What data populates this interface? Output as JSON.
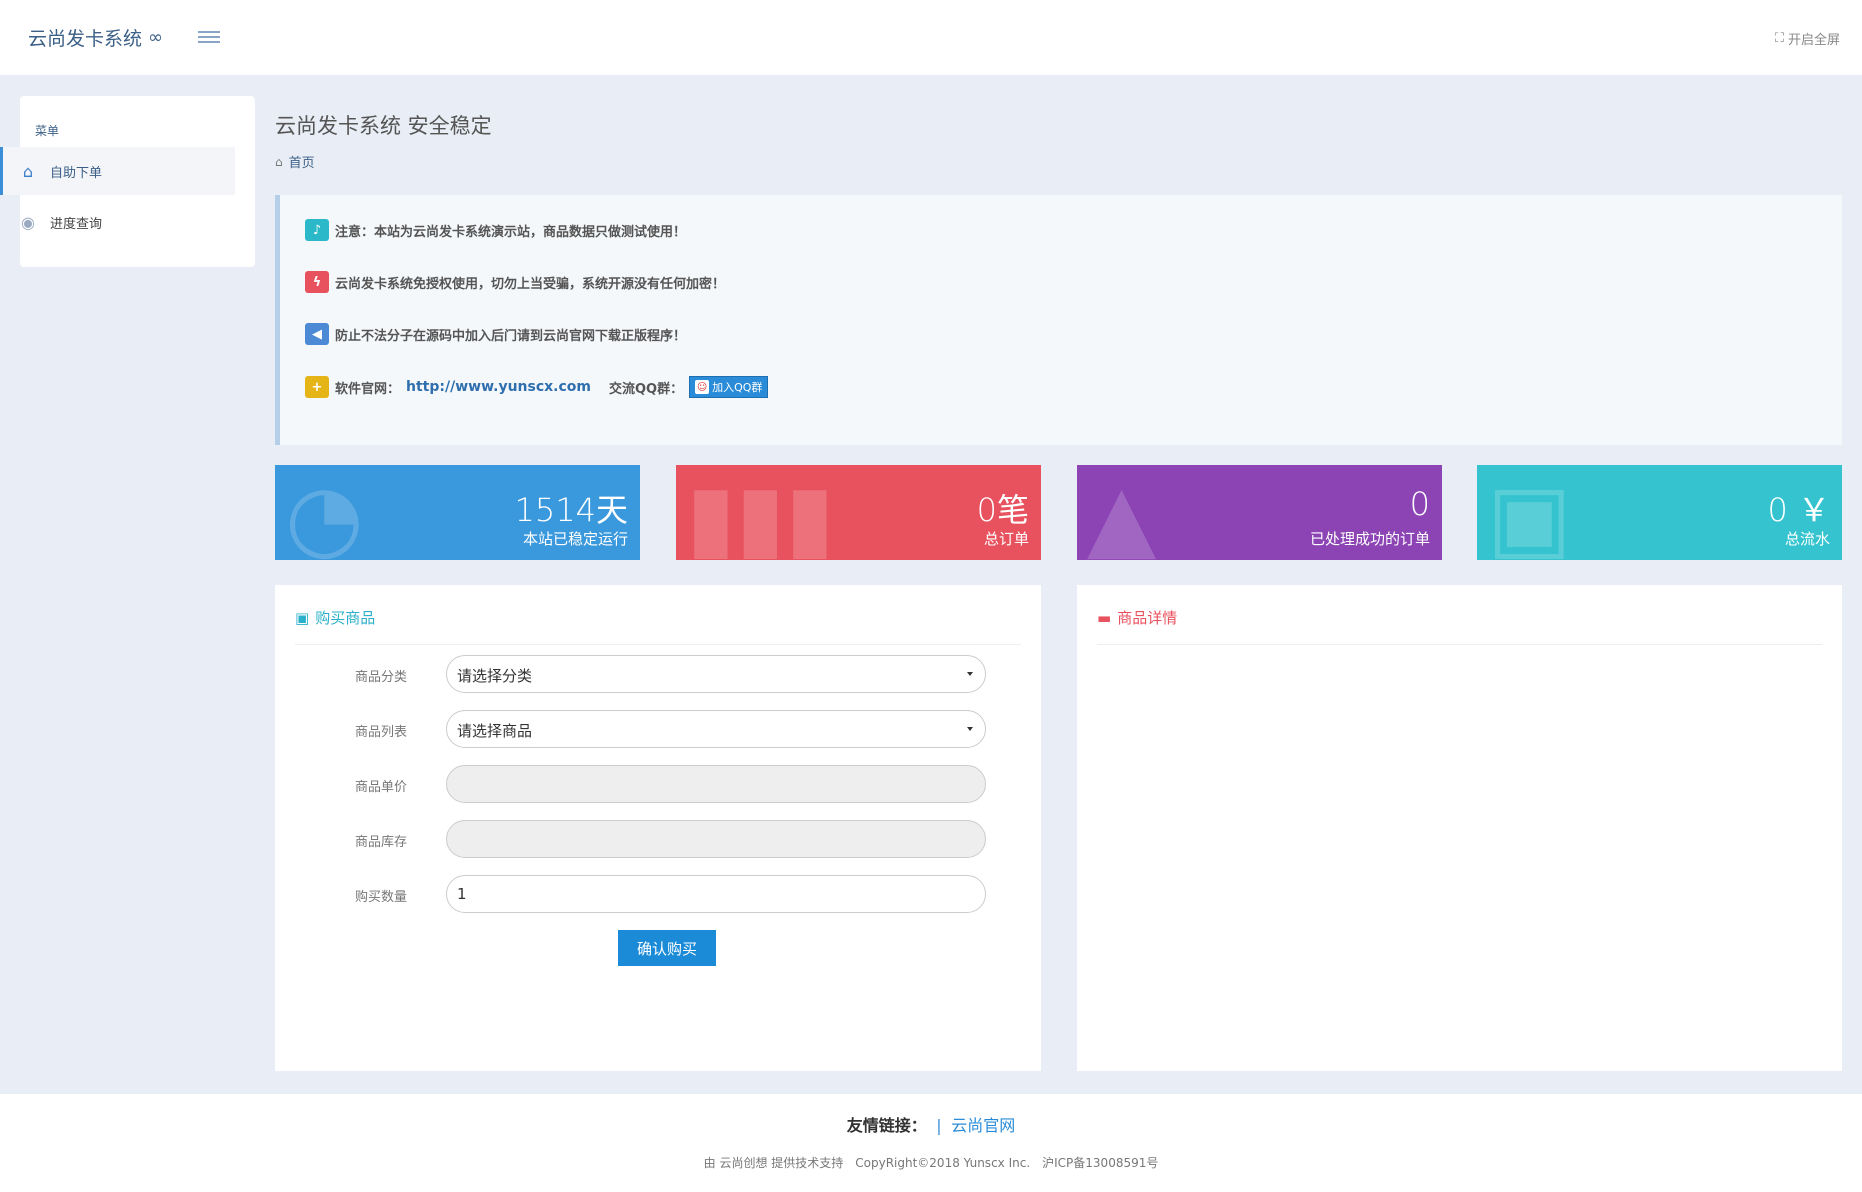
{
  "header": {
    "brand": "云尚发卡系统",
    "fullscreen": "开启全屏"
  },
  "sidebar": {
    "heading": "菜单",
    "items": [
      {
        "label": "自助下单"
      },
      {
        "label": "进度查询"
      }
    ]
  },
  "page": {
    "title": "云尚发卡系统 安全稳定",
    "breadcrumb": "首页"
  },
  "notice": {
    "line1": "注意：本站为云尚发卡系统演示站，商品数据只做测试使用！",
    "line2": "云尚发卡系统免授权使用，切勿上当受骗，系统开源没有任何加密！",
    "line3": "防止不法分子在源码中加入后门请到云尚官网下载正版程序！",
    "site_label": "软件官网：",
    "site_url": "http://www.yunscx.com",
    "qq_label": "交流QQ群：",
    "qq_button": "加入QQ群"
  },
  "stats": [
    {
      "value": "1514天",
      "label": "本站已稳定运行",
      "color": "#3a98dc"
    },
    {
      "value": "0笔",
      "label": "总订单",
      "color": "#e8525e"
    },
    {
      "value": "0",
      "label": "已处理成功的订单",
      "color": "#8c44b5"
    },
    {
      "value": "0 ￥",
      "label": "总流水",
      "color": "#35c4cf"
    }
  ],
  "buy_panel": {
    "title": "购买商品",
    "category_label": "商品分类",
    "category_value": "请选择分类",
    "product_label": "商品列表",
    "product_value": "请选择商品",
    "price_label": "商品单价",
    "price_value": "",
    "stock_label": "商品库存",
    "stock_value": "",
    "qty_label": "购买数量",
    "qty_value": "1",
    "confirm": "确认购买"
  },
  "detail_panel": {
    "title": "商品详情"
  },
  "footer": {
    "links_label": "友情链接：",
    "sep": "|",
    "link1": "云尚官网",
    "copyright": "由 云尚创想 提供技术支持　CopyRight©2018 Yunscx Inc.　沪ICP备13008591号"
  }
}
